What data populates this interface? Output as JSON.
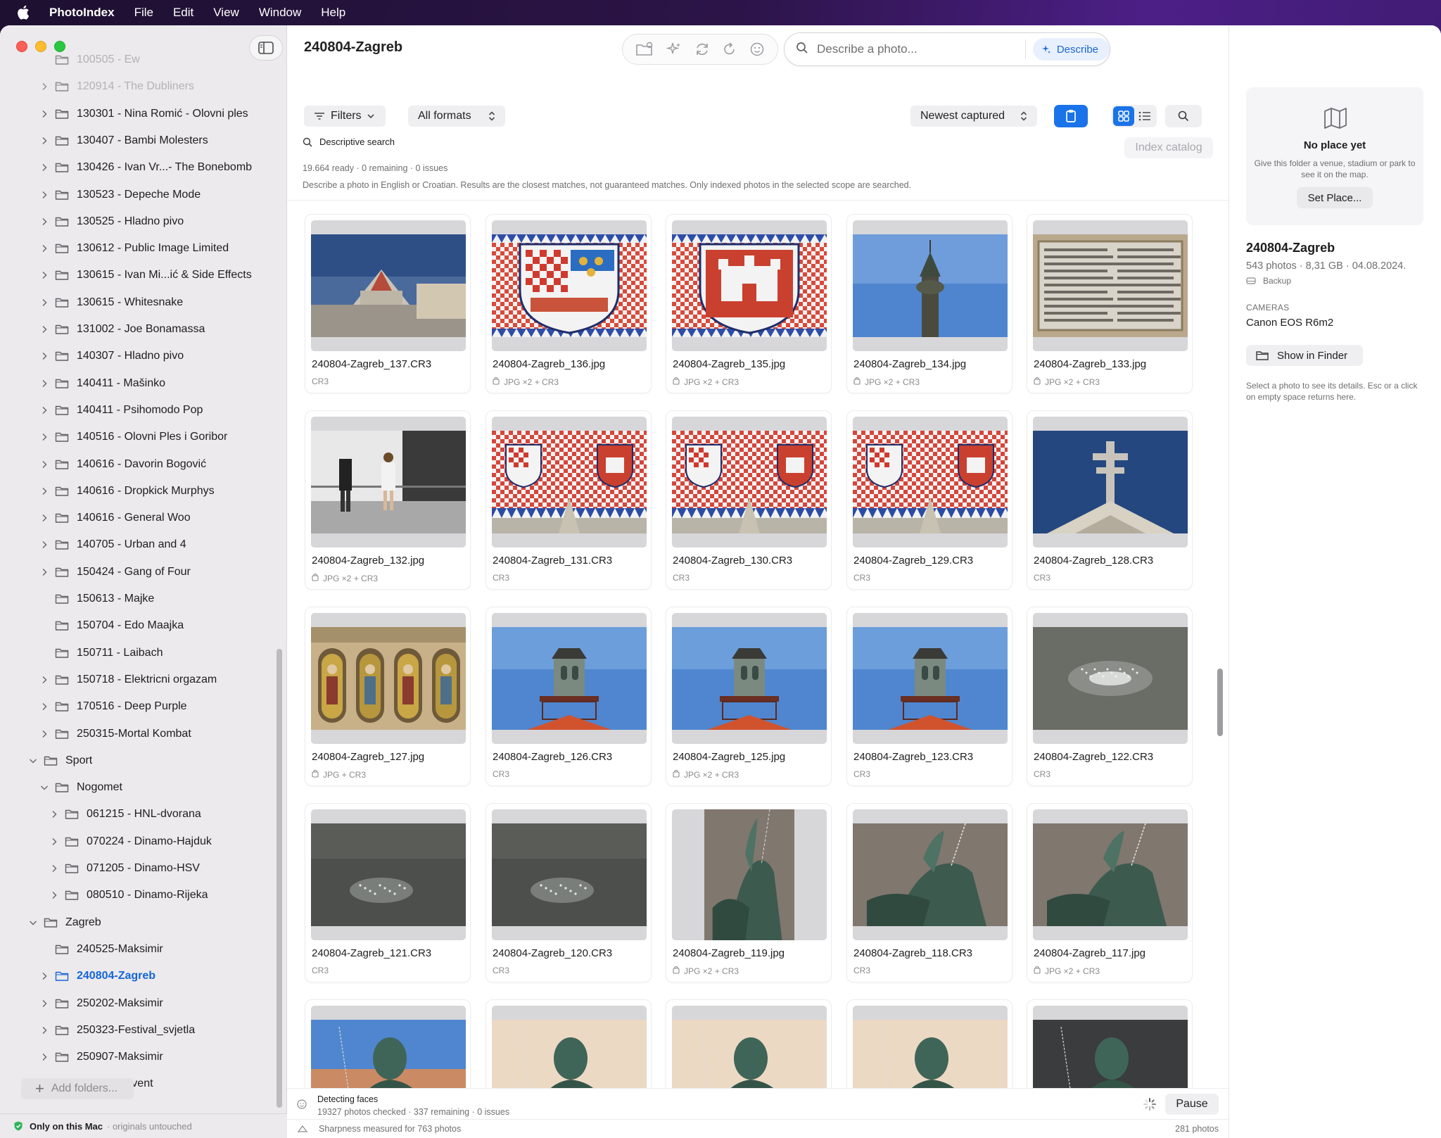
{
  "menubar": {
    "app_name": "PhotoIndex",
    "items": [
      "File",
      "Edit",
      "View",
      "Window",
      "Help"
    ]
  },
  "sidebar": {
    "folders": [
      {
        "label": "100505 - Ew",
        "depth": 2,
        "chevron": "none",
        "faded": true
      },
      {
        "label": "120914 - The Dubliners",
        "depth": 2,
        "chevron": "right",
        "faded": true
      },
      {
        "label": "130301 - Nina Romić - Olovni ples",
        "depth": 2,
        "chevron": "right"
      },
      {
        "label": "130407 - Bambi Molesters",
        "depth": 2,
        "chevron": "right"
      },
      {
        "label": "130426 - Ivan Vr...- The Bonebomb",
        "depth": 2,
        "chevron": "right"
      },
      {
        "label": "130523 - Depeche Mode",
        "depth": 2,
        "chevron": "right"
      },
      {
        "label": "130525 - Hladno pivo",
        "depth": 2,
        "chevron": "right"
      },
      {
        "label": "130612 - Public Image Limited",
        "depth": 2,
        "chevron": "right"
      },
      {
        "label": "130615 - Ivan Mi...ić & Side Effects",
        "depth": 2,
        "chevron": "right"
      },
      {
        "label": "130615 - Whitesnake",
        "depth": 2,
        "chevron": "right"
      },
      {
        "label": "131002 - Joe Bonamassa",
        "depth": 2,
        "chevron": "right"
      },
      {
        "label": "140307 - Hladno pivo",
        "depth": 2,
        "chevron": "right"
      },
      {
        "label": "140411 - Mašinko",
        "depth": 2,
        "chevron": "right"
      },
      {
        "label": "140411 - Psihomodo Pop",
        "depth": 2,
        "chevron": "right"
      },
      {
        "label": "140516 - Olovni Ples i Goribor",
        "depth": 2,
        "chevron": "right"
      },
      {
        "label": "140616 - Davorin Bogović",
        "depth": 2,
        "chevron": "right"
      },
      {
        "label": "140616 - Dropkick Murphys",
        "depth": 2,
        "chevron": "right"
      },
      {
        "label": "140616 - General Woo",
        "depth": 2,
        "chevron": "right"
      },
      {
        "label": "140705 - Urban and 4",
        "depth": 2,
        "chevron": "right"
      },
      {
        "label": "150424 - Gang of Four",
        "depth": 2,
        "chevron": "right"
      },
      {
        "label": "150613 - Majke",
        "depth": 2,
        "chevron": "none"
      },
      {
        "label": "150704 - Edo Maajka",
        "depth": 2,
        "chevron": "none"
      },
      {
        "label": "150711 - Laibach",
        "depth": 2,
        "chevron": "none"
      },
      {
        "label": "150718 - Elektricni orgazam",
        "depth": 2,
        "chevron": "right"
      },
      {
        "label": "170516 - Deep Purple",
        "depth": 2,
        "chevron": "right"
      },
      {
        "label": "250315-Mortal Kombat",
        "depth": 2,
        "chevron": "right"
      },
      {
        "label": "Sport",
        "depth": 1,
        "chevron": "down"
      },
      {
        "label": "Nogomet",
        "depth": 2,
        "chevron": "down"
      },
      {
        "label": "061215 - HNL-dvorana",
        "depth": 3,
        "chevron": "right"
      },
      {
        "label": "070224 - Dinamo-Hajduk",
        "depth": 3,
        "chevron": "right"
      },
      {
        "label": "071205 - Dinamo-HSV",
        "depth": 3,
        "chevron": "right"
      },
      {
        "label": "080510 - Dinamo-Rijeka",
        "depth": 3,
        "chevron": "right"
      },
      {
        "label": "Zagreb",
        "depth": 1,
        "chevron": "down"
      },
      {
        "label": "240525-Maksimir",
        "depth": 2,
        "chevron": "none"
      },
      {
        "label": "240804-Zagreb",
        "depth": 2,
        "chevron": "right",
        "selected": true
      },
      {
        "label": "250202-Maksimir",
        "depth": 2,
        "chevron": "right"
      },
      {
        "label": "250323-Festival_svjetla",
        "depth": 2,
        "chevron": "right"
      },
      {
        "label": "250907-Maksimir",
        "depth": 2,
        "chevron": "right"
      },
      {
        "label": "251228-Advent",
        "depth": 2,
        "chevron": "right"
      }
    ],
    "add_folders_label": "Add folders...",
    "footer_bold": "Only on this Mac",
    "footer_muted": "· originals untouched"
  },
  "main": {
    "title": "240804-Zagreb",
    "search_placeholder": "Describe a photo...",
    "describe_label": "Describe",
    "filters_label": "Filters",
    "formats_label": "All formats",
    "sort_label": "Newest captured",
    "descriptive_search_label": "Descriptive search",
    "index_catalog_label": "Index catalog",
    "status_line": "19.664 ready · 0 remaining · 0 issues",
    "hint_line": "Describe a photo in English or Croatian. Results are the closest matches, not guaranteed matches. Only indexed photos in the selected scope are searched.",
    "photos": [
      {
        "name": "240804-Zagreb_137.CR3",
        "formats": "CR3",
        "stack": false,
        "img": "church"
      },
      {
        "name": "240804-Zagreb_136.jpg",
        "formats": "JPG ×2 + CR3",
        "stack": true,
        "img": "crest-tile"
      },
      {
        "name": "240804-Zagreb_135.jpg",
        "formats": "JPG ×2 + CR3",
        "stack": true,
        "img": "castle-tile"
      },
      {
        "name": "240804-Zagreb_134.jpg",
        "formats": "JPG ×2 + CR3",
        "stack": true,
        "img": "spire"
      },
      {
        "name": "240804-Zagreb_133.jpg",
        "formats": "JPG ×2 + CR3",
        "stack": true,
        "img": "plaque"
      },
      {
        "name": "240804-Zagreb_132.jpg",
        "formats": "JPG ×2 + CR3",
        "stack": true,
        "img": "tourists"
      },
      {
        "name": "240804-Zagreb_131.CR3",
        "formats": "CR3",
        "stack": false,
        "img": "roof"
      },
      {
        "name": "240804-Zagreb_130.CR3",
        "formats": "CR3",
        "stack": false,
        "img": "roof"
      },
      {
        "name": "240804-Zagreb_129.CR3",
        "formats": "CR3",
        "stack": false,
        "img": "roof"
      },
      {
        "name": "240804-Zagreb_128.CR3",
        "formats": "CR3",
        "stack": false,
        "img": "cross"
      },
      {
        "name": "240804-Zagreb_127.jpg",
        "formats": "JPG + CR3",
        "stack": true,
        "img": "mosaic"
      },
      {
        "name": "240804-Zagreb_126.CR3",
        "formats": "CR3",
        "stack": false,
        "img": "tower"
      },
      {
        "name": "240804-Zagreb_125.jpg",
        "formats": "JPG ×2 + CR3",
        "stack": true,
        "img": "tower"
      },
      {
        "name": "240804-Zagreb_123.CR3",
        "formats": "CR3",
        "stack": false,
        "img": "tower"
      },
      {
        "name": "240804-Zagreb_122.CR3",
        "formats": "CR3",
        "stack": false,
        "img": "splash"
      },
      {
        "name": "240804-Zagreb_121.CR3",
        "formats": "CR3",
        "stack": false,
        "img": "water"
      },
      {
        "name": "240804-Zagreb_120.CR3",
        "formats": "CR3",
        "stack": false,
        "img": "water"
      },
      {
        "name": "240804-Zagreb_119.jpg",
        "formats": "JPG ×2 + CR3",
        "stack": true,
        "img": "fountain-portrait"
      },
      {
        "name": "240804-Zagreb_118.CR3",
        "formats": "CR3",
        "stack": false,
        "img": "fountain"
      },
      {
        "name": "240804-Zagreb_117.jpg",
        "formats": "JPG ×2 + CR3",
        "stack": true,
        "img": "fountain"
      },
      {
        "name": "",
        "formats": "",
        "stack": false,
        "img": "statue-sky"
      },
      {
        "name": "",
        "formats": "",
        "stack": false,
        "img": "statue"
      },
      {
        "name": "",
        "formats": "",
        "stack": false,
        "img": "statue"
      },
      {
        "name": "",
        "formats": "",
        "stack": false,
        "img": "statue"
      },
      {
        "name": "",
        "formats": "",
        "stack": false,
        "img": "statue-dark"
      }
    ],
    "progress_title": "Detecting faces",
    "progress_sub": "19327 photos checked · 337 remaining · 0 issues",
    "pause_label": "Pause",
    "footer_left": "Sharpness measured for 763 photos",
    "footer_right": "281 photos"
  },
  "right_panel": {
    "place_title": "No place yet",
    "place_desc": "Give this folder a venue, stadium or park to see it on the map.",
    "set_place_label": "Set Place...",
    "folder_title": "240804-Zagreb",
    "folder_meta": "543 photos · 8,31 GB · 04.08.2024.",
    "backup_label": "Backup",
    "cameras_label": "CAMERAS",
    "camera_name": "Canon EOS R6m2",
    "show_in_finder_label": "Show in Finder",
    "hint": "Select a photo to see its details. Esc or a click on empty space returns here."
  },
  "colors": {
    "accent": "#1a73e8",
    "selected_text": "#1565d8",
    "sidebar_bg": "#eceaec",
    "traffic_red": "#fe5f57",
    "traffic_yellow": "#febc2e",
    "traffic_green": "#28c840"
  }
}
